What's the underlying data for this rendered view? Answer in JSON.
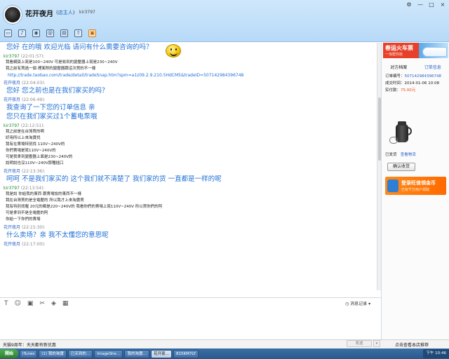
{
  "header": {
    "contact_name": "花开夜月",
    "contact_role": "店主人",
    "contact_id": "kir3797",
    "window_controls": [
      "⚙",
      "—",
      "□",
      "×"
    ]
  },
  "chat": {
    "messages": [
      {
        "type": "big",
        "text": "您好  在的哦  欢迎光临  请问有什么需要咨询的吗？"
      },
      {
        "type": "head",
        "name": "kir3797",
        "time": "(22:01:57):",
        "who": "me"
      },
      {
        "type": "small",
        "text": "我看網頁上寫是100~240V 可是收到的變壓器上寫是230~240V"
      },
      {
        "type": "small",
        "text": "我之前有買過一個  裡面附的變壓器跟這次買的不一樣"
      },
      {
        "type": "link",
        "text": "http://trade.taobao.com/trade/detail/tradeSnap.htm?spm=a1z09.2.9.210.5HdCM5&tradeID=507142984396748"
      },
      {
        "type": "head",
        "name": "花开夜月",
        "time": "(22:04:03):",
        "who": "shop"
      },
      {
        "type": "big",
        "text": "您好  您之前也是在我们家买的吗？"
      },
      {
        "type": "head",
        "name": "花开夜月",
        "time": "(22:06:49):",
        "who": "shop"
      },
      {
        "type": "big",
        "text": "我查询了一下您的订单信息 亲"
      },
      {
        "type": "big",
        "text": "您只在我们家买过1个蓄电泵哦"
      },
      {
        "type": "head",
        "name": "kir3797",
        "time": "(22:12:51):",
        "who": "me"
      },
      {
        "type": "small",
        "text": "我之前是在台灣買的啊"
      },
      {
        "type": "small",
        "text": "好用所以上來淘寶找"
      },
      {
        "type": "small",
        "text": "我有在賣場特別找 110V~240V的"
      },
      {
        "type": "small",
        "text": "你們賣場是寫110V~240V的"
      },
      {
        "type": "small",
        "text": "可是我拿到變壓器上面是230~240V的"
      },
      {
        "type": "small",
        "text": "說明說也沒110V~240V那種插口"
      },
      {
        "type": "head",
        "name": "花开夜月",
        "time": "(22:13:36):",
        "who": "shop"
      },
      {
        "type": "big",
        "text": "呵呵 不是我们家买的 这个我们就不清楚了 我们家的货 一直都是一样的呢"
      },
      {
        "type": "head",
        "name": "kir3797",
        "time": "(22:13:54):",
        "who": "me"
      },
      {
        "type": "small",
        "text": "我是說 你給我的東西 跟賣場說的東西不一樣"
      },
      {
        "type": "small",
        "text": "我在台灣買的是全電壓的  所以我才上來淘寶買"
      },
      {
        "type": "small",
        "text": "我有特別找喔 20元的都是220~240V的 我看你們的賣場上寫110V~240V 所以買你們的阿"
      },
      {
        "type": "small",
        "text": "可是拿到不是全電壓的阿"
      },
      {
        "type": "small",
        "text": "你給一下你們的賣場"
      },
      {
        "type": "head",
        "name": "花开夜月",
        "time": "(22:15:30):",
        "who": "shop"
      },
      {
        "type": "big",
        "text": "什么卖场？亲  我不太懂您的意思呢"
      },
      {
        "type": "head",
        "name": "花开夜月",
        "time": "(22:17:00):",
        "who": "shop"
      }
    ]
  },
  "input_bar": {
    "history_label": "消息记录"
  },
  "footer": {
    "left_text": "天猫9周年：天天都有新优惠",
    "send_label": "发送",
    "right_text": "点击查看本店推荐"
  },
  "right_panel": {
    "banner_title": "春运火车票",
    "banner_sub": "一淘帮你抢",
    "tabs": [
      "对方档案",
      "订单信息"
    ],
    "order_no_label": "订单编号：",
    "order_no": "507142984396748",
    "deal_time_label": "成交时间：",
    "deal_time": "2014-01-06 10:08",
    "paid_label": "实付款：",
    "paid": "75.00元",
    "shipped_label": "已发货",
    "logistics_label": "查看物流",
    "confirm_label": "确认收货",
    "promo_title": "登录旺信领金币",
    "promo_sub": "已有千万用户领取"
  },
  "taskbar": {
    "start": "開始",
    "tasks": [
      "iTunes",
      "(1) 我的淘寶",
      "已买到的…",
      "ImageShe…",
      "我的淘寶…",
      "花开夜…",
      "815KM7LY"
    ],
    "clock": "下午 10:46"
  },
  "colors": {
    "accent": "#1f6fd6",
    "header_bg": "#cfe7fb",
    "price": "#e84b1f"
  }
}
